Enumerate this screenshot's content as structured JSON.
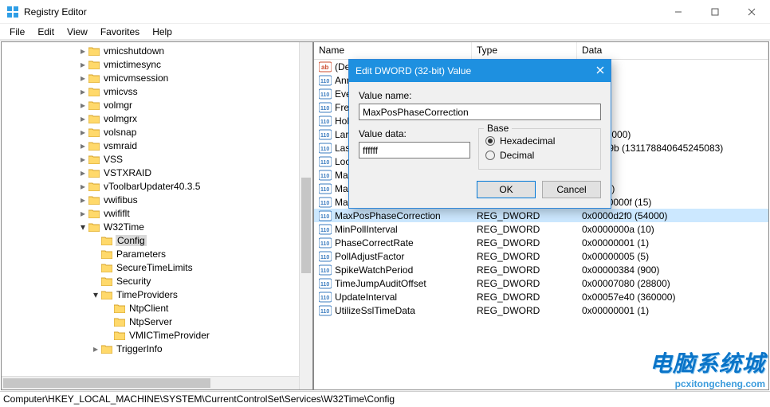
{
  "window": {
    "title": "Registry Editor"
  },
  "winctrl": {
    "min": "minimize",
    "max": "maximize",
    "close": "close"
  },
  "menu": {
    "file": "File",
    "edit": "Edit",
    "view": "View",
    "fav": "Favorites",
    "help": "Help"
  },
  "tree": [
    {
      "indent": 6,
      "chev": ">",
      "name": "vmicshutdown"
    },
    {
      "indent": 6,
      "chev": ">",
      "name": "vmictimesync"
    },
    {
      "indent": 6,
      "chev": ">",
      "name": "vmicvmsession"
    },
    {
      "indent": 6,
      "chev": ">",
      "name": "vmicvss"
    },
    {
      "indent": 6,
      "chev": ">",
      "name": "volmgr"
    },
    {
      "indent": 6,
      "chev": ">",
      "name": "volmgrx"
    },
    {
      "indent": 6,
      "chev": ">",
      "name": "volsnap"
    },
    {
      "indent": 6,
      "chev": ">",
      "name": "vsmraid"
    },
    {
      "indent": 6,
      "chev": ">",
      "name": "VSS"
    },
    {
      "indent": 6,
      "chev": ">",
      "name": "VSTXRAID"
    },
    {
      "indent": 6,
      "chev": ">",
      "name": "vToolbarUpdater40.3.5"
    },
    {
      "indent": 6,
      "chev": ">",
      "name": "vwifibus"
    },
    {
      "indent": 6,
      "chev": ">",
      "name": "vwififlt"
    },
    {
      "indent": 6,
      "chev": "v",
      "name": "W32Time"
    },
    {
      "indent": 7,
      "chev": "",
      "name": "Config",
      "sel": true
    },
    {
      "indent": 7,
      "chev": "",
      "name": "Parameters"
    },
    {
      "indent": 7,
      "chev": "",
      "name": "SecureTimeLimits"
    },
    {
      "indent": 7,
      "chev": "",
      "name": "Security"
    },
    {
      "indent": 7,
      "chev": "v",
      "name": "TimeProviders"
    },
    {
      "indent": 8,
      "chev": "",
      "name": "NtpClient"
    },
    {
      "indent": 8,
      "chev": "",
      "name": "NtpServer"
    },
    {
      "indent": 8,
      "chev": "",
      "name": "VMICTimeProvider"
    },
    {
      "indent": 7,
      "chev": ">",
      "name": "TriggerInfo"
    }
  ],
  "list": {
    "headers": {
      "name": "Name",
      "type": "Type",
      "data": "Data"
    },
    "rows": [
      {
        "ico": "sz",
        "name": "(Defa",
        "type": "",
        "data": "et)",
        "clip": true
      },
      {
        "ico": "dw",
        "name": "Anno",
        "type": "",
        "data": "(10)",
        "clip": true
      },
      {
        "ico": "dw",
        "name": "Even",
        "type": "",
        "data": "(2)",
        "clip": true
      },
      {
        "ico": "dw",
        "name": "Freq",
        "type": "",
        "data": "(4)",
        "clip": true
      },
      {
        "ico": "dw",
        "name": "Hold",
        "type": "",
        "data": "(5)",
        "clip": true
      },
      {
        "ico": "dw",
        "name": "Larg",
        "type": "",
        "data": "(50000000)",
        "clip": true
      },
      {
        "ico": "dw",
        "name": "Lasth",
        "type": "",
        "data": "6b5189b (131178840645245083)",
        "clip": true
      },
      {
        "ico": "dw",
        "name": "Loca",
        "type": "",
        "data": "(10)",
        "clip": true
      },
      {
        "ico": "dw",
        "name": "Max/",
        "type": "",
        "data": "",
        "clip": true
      },
      {
        "ico": "dw",
        "name": "Max!",
        "type": "",
        "data": "(54000)",
        "clip": true
      },
      {
        "ico": "dw",
        "name": "MaxPollInterval",
        "type": "REG_DWORD",
        "data": "0x0000000f (15)"
      },
      {
        "ico": "dw",
        "name": "MaxPosPhaseCorrection",
        "type": "REG_DWORD",
        "data": "0x0000d2f0 (54000)",
        "sel": true
      },
      {
        "ico": "dw",
        "name": "MinPollInterval",
        "type": "REG_DWORD",
        "data": "0x0000000a (10)"
      },
      {
        "ico": "dw",
        "name": "PhaseCorrectRate",
        "type": "REG_DWORD",
        "data": "0x00000001 (1)"
      },
      {
        "ico": "dw",
        "name": "PollAdjustFactor",
        "type": "REG_DWORD",
        "data": "0x00000005 (5)"
      },
      {
        "ico": "dw",
        "name": "SpikeWatchPeriod",
        "type": "REG_DWORD",
        "data": "0x00000384 (900)"
      },
      {
        "ico": "dw",
        "name": "TimeJumpAuditOffset",
        "type": "REG_DWORD",
        "data": "0x00007080 (28800)"
      },
      {
        "ico": "dw",
        "name": "UpdateInterval",
        "type": "REG_DWORD",
        "data": "0x00057e40 (360000)"
      },
      {
        "ico": "dw",
        "name": "UtilizeSslTimeData",
        "type": "REG_DWORD",
        "data": "0x00000001 (1)"
      }
    ]
  },
  "dialog": {
    "title": "Edit DWORD (32-bit) Value",
    "name_label": "Value name:",
    "name_value": "MaxPosPhaseCorrection",
    "data_label": "Value data:",
    "data_value": "ffffff",
    "base_label": "Base",
    "hex": "Hexadecimal",
    "dec": "Decimal",
    "ok": "OK",
    "cancel": "Cancel"
  },
  "status": "Computer\\HKEY_LOCAL_MACHINE\\SYSTEM\\CurrentControlSet\\Services\\W32Time\\Config",
  "watermark": {
    "a": "电脑系统城",
    "b": "pcxitongcheng.com"
  }
}
